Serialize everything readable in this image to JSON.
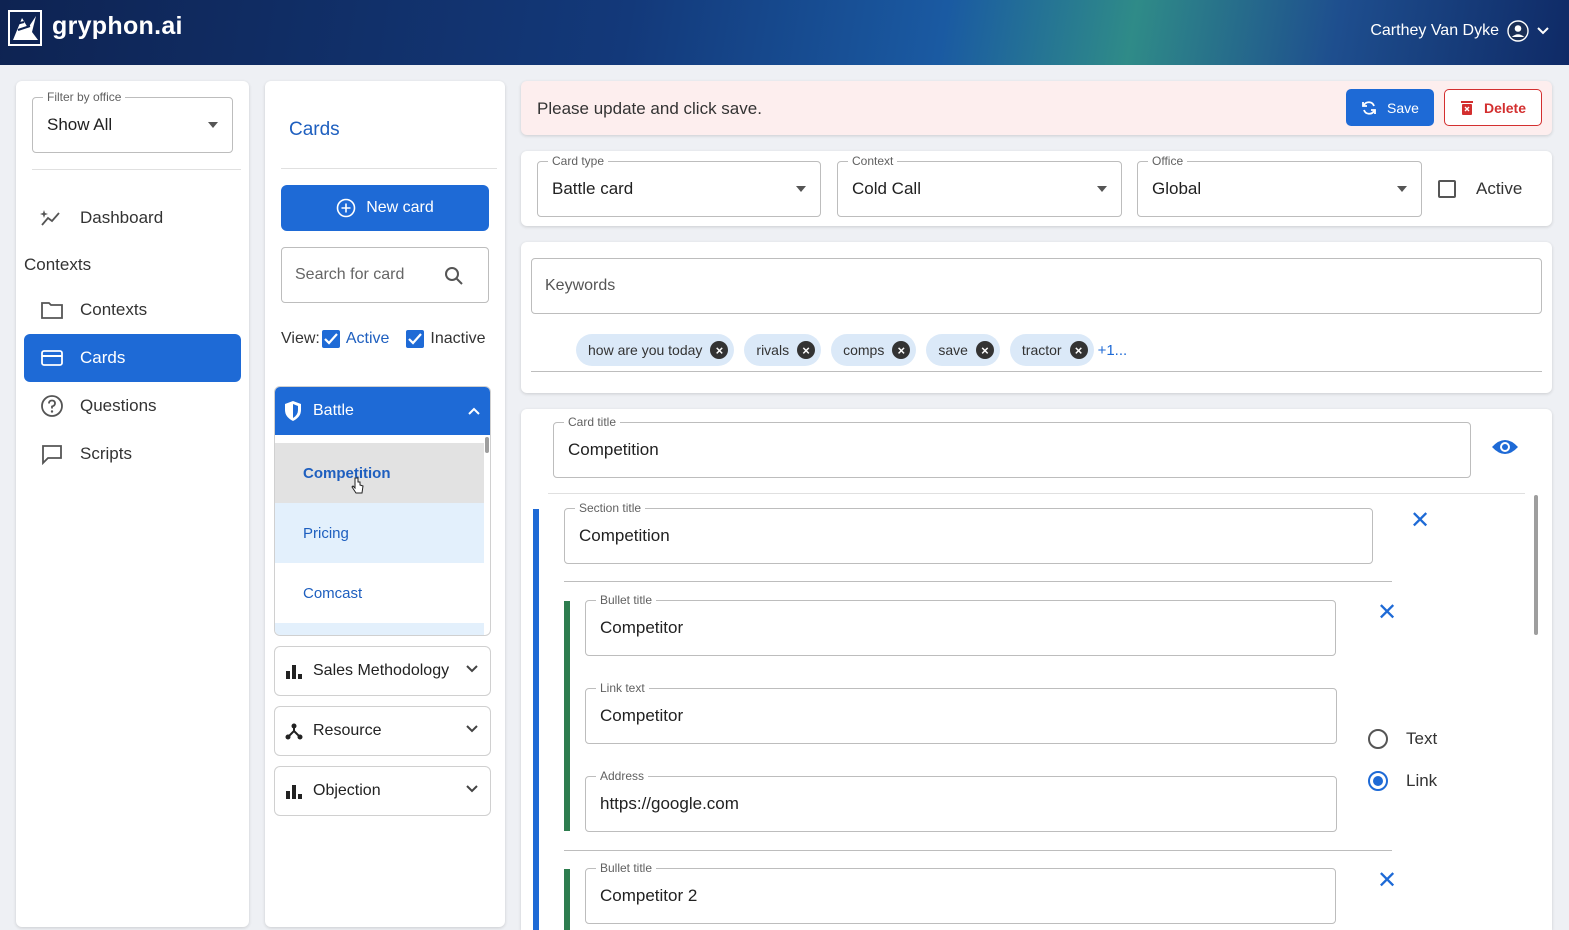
{
  "app": {
    "brand": "gryphon.ai",
    "user": "Carthey Van Dyke"
  },
  "sidebar": {
    "filter_label": "Filter by office",
    "filter_value": "Show All",
    "items": [
      {
        "label": "Dashboard",
        "icon": "dashboard-icon"
      },
      {
        "section": "Contexts"
      },
      {
        "label": "Contexts",
        "icon": "folder-icon"
      },
      {
        "label": "Cards",
        "icon": "card-icon",
        "active": true
      },
      {
        "label": "Questions",
        "icon": "question-icon"
      },
      {
        "label": "Scripts",
        "icon": "chat-icon"
      }
    ]
  },
  "cards_panel": {
    "title": "Cards",
    "new_card": "New card",
    "search_placeholder": "Search for card",
    "view_label": "View:",
    "view_active": "Active",
    "view_inactive": "Inactive",
    "groups": [
      {
        "label": "Battle",
        "expanded": true,
        "items": [
          "Competition",
          "Pricing",
          "Comcast"
        ]
      },
      {
        "label": "Sales Methodology"
      },
      {
        "label": "Resource"
      },
      {
        "label": "Objection"
      }
    ]
  },
  "banner": {
    "message": "Please update and click save.",
    "save": "Save",
    "delete": "Delete"
  },
  "card_meta": {
    "card_type_label": "Card type",
    "card_type": "Battle card",
    "context_label": "Context",
    "context": "Cold Call",
    "office_label": "Office",
    "office": "Global",
    "active_label": "Active"
  },
  "keywords": {
    "placeholder": "Keywords",
    "chips": [
      "how are you today",
      "rivals",
      "comps",
      "save",
      "tractor"
    ],
    "more": "+1..."
  },
  "editor": {
    "card_title_label": "Card title",
    "card_title": "Competition",
    "section_title_label": "Section title",
    "section_title": "Competition",
    "bullet1_label": "Bullet title",
    "bullet1": "Competitor",
    "link_text_label": "Link text",
    "link_text": "Competitor",
    "address_label": "Address",
    "address": "https://google.com",
    "radio_text": "Text",
    "radio_link": "Link",
    "bullet2_label": "Bullet title",
    "bullet2": "Competitor 2"
  },
  "colors": {
    "accent": "#1e6ad6",
    "green_bar": "#2e7d4f",
    "banner_bg": "#fdeeee",
    "delete": "#d32f2f"
  }
}
